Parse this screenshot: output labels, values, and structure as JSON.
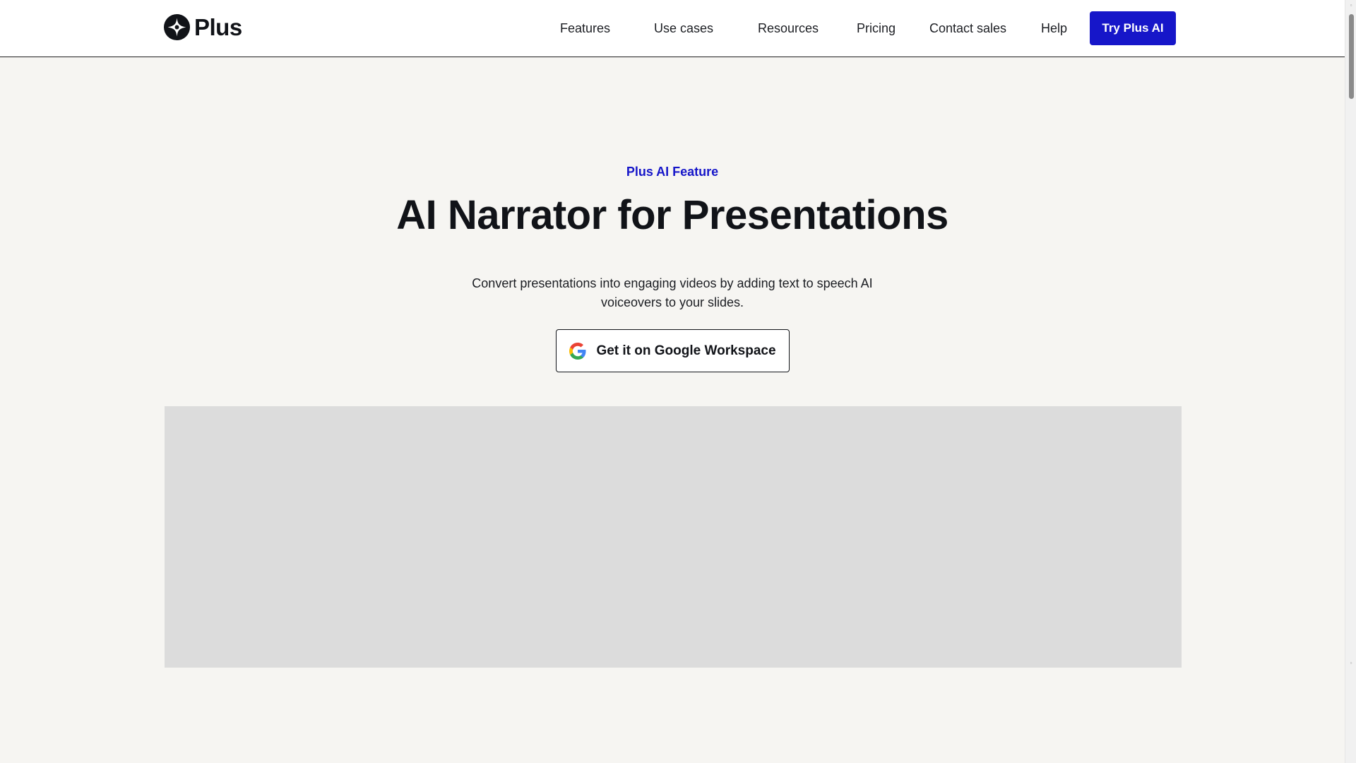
{
  "header": {
    "logo_text": "Plus",
    "nav": [
      {
        "label": "Features"
      },
      {
        "label": "Use cases"
      },
      {
        "label": "Resources"
      },
      {
        "label": "Pricing"
      },
      {
        "label": "Contact sales"
      },
      {
        "label": "Help"
      }
    ],
    "cta_label": "Try Plus AI"
  },
  "hero": {
    "eyebrow": "Plus AI Feature",
    "title": "AI Narrator for Presentations",
    "subtitle": "Convert presentations into engaging videos by adding text to speech AI voiceovers to your slides.",
    "button_label": "Get it on Google Workspace",
    "button_icon": "google-icon"
  },
  "colors": {
    "accent": "#1616c9",
    "background": "#f6f5f2",
    "placeholder": "#dcdcdc",
    "text": "#111318"
  }
}
